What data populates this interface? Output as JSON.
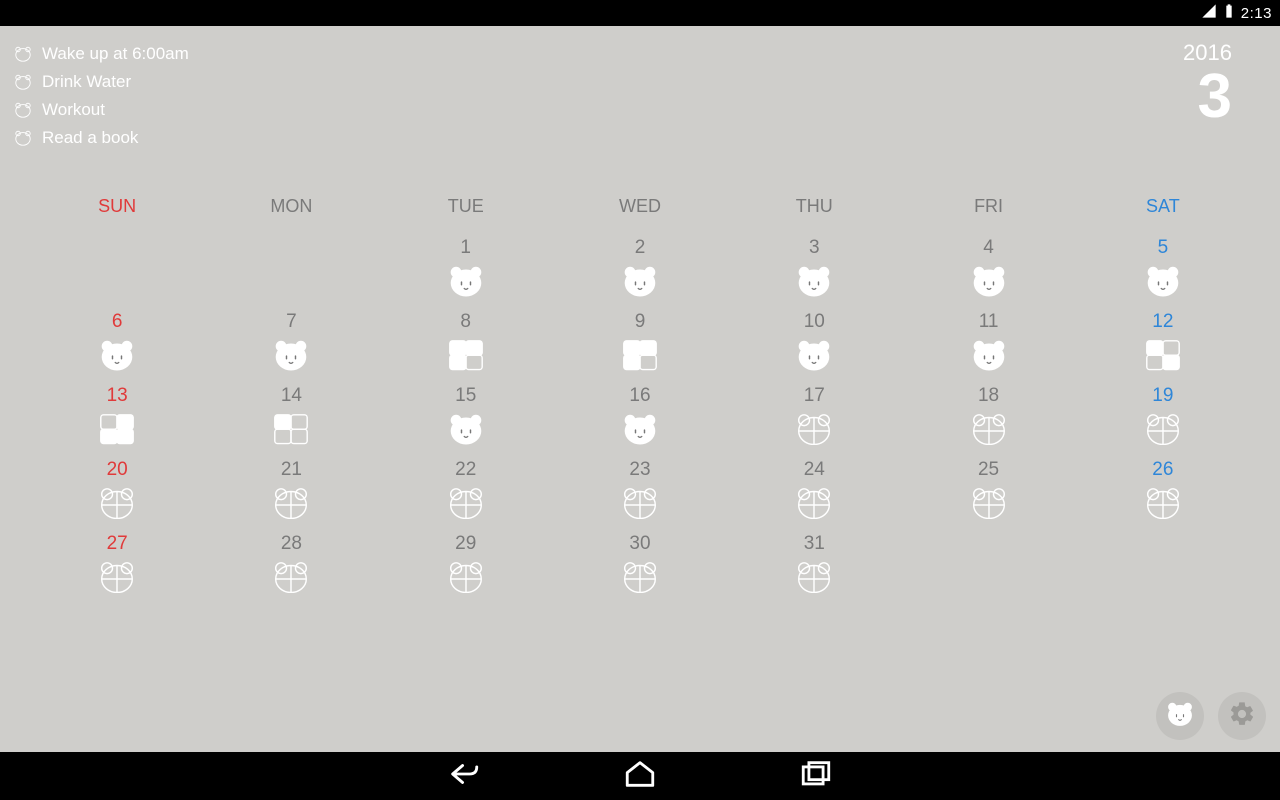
{
  "status": {
    "time": "2:13"
  },
  "tasks": [
    {
      "label": "Wake up at 6:00am"
    },
    {
      "label": "Drink Water"
    },
    {
      "label": "Workout"
    },
    {
      "label": "Read a book"
    }
  ],
  "header": {
    "year": "2016",
    "month": "3"
  },
  "dow": [
    "SUN",
    "MON",
    "TUE",
    "WED",
    "THU",
    "FRI",
    "SAT"
  ],
  "weeks": [
    [
      {
        "d": "",
        "s": ""
      },
      {
        "d": "",
        "s": ""
      },
      {
        "d": "1",
        "s": "bear"
      },
      {
        "d": "2",
        "s": "bear"
      },
      {
        "d": "3",
        "s": "bear"
      },
      {
        "d": "4",
        "s": "bear"
      },
      {
        "d": "5",
        "s": "bear"
      }
    ],
    [
      {
        "d": "6",
        "s": "bear"
      },
      {
        "d": "7",
        "s": "bear"
      },
      {
        "d": "8",
        "s": "p3a"
      },
      {
        "d": "9",
        "s": "p3a"
      },
      {
        "d": "10",
        "s": "bear"
      },
      {
        "d": "11",
        "s": "bear"
      },
      {
        "d": "12",
        "s": "p2"
      }
    ],
    [
      {
        "d": "13",
        "s": "p3b"
      },
      {
        "d": "14",
        "s": "p1"
      },
      {
        "d": "15",
        "s": "bear"
      },
      {
        "d": "16",
        "s": "bear"
      },
      {
        "d": "17",
        "s": "empty"
      },
      {
        "d": "18",
        "s": "empty"
      },
      {
        "d": "19",
        "s": "empty"
      }
    ],
    [
      {
        "d": "20",
        "s": "empty"
      },
      {
        "d": "21",
        "s": "empty"
      },
      {
        "d": "22",
        "s": "empty"
      },
      {
        "d": "23",
        "s": "empty"
      },
      {
        "d": "24",
        "s": "empty"
      },
      {
        "d": "25",
        "s": "empty"
      },
      {
        "d": "26",
        "s": "empty"
      }
    ],
    [
      {
        "d": "27",
        "s": "empty"
      },
      {
        "d": "28",
        "s": "empty"
      },
      {
        "d": "29",
        "s": "empty"
      },
      {
        "d": "30",
        "s": "empty"
      },
      {
        "d": "31",
        "s": "empty"
      },
      {
        "d": "",
        "s": ""
      },
      {
        "d": "",
        "s": ""
      }
    ]
  ]
}
